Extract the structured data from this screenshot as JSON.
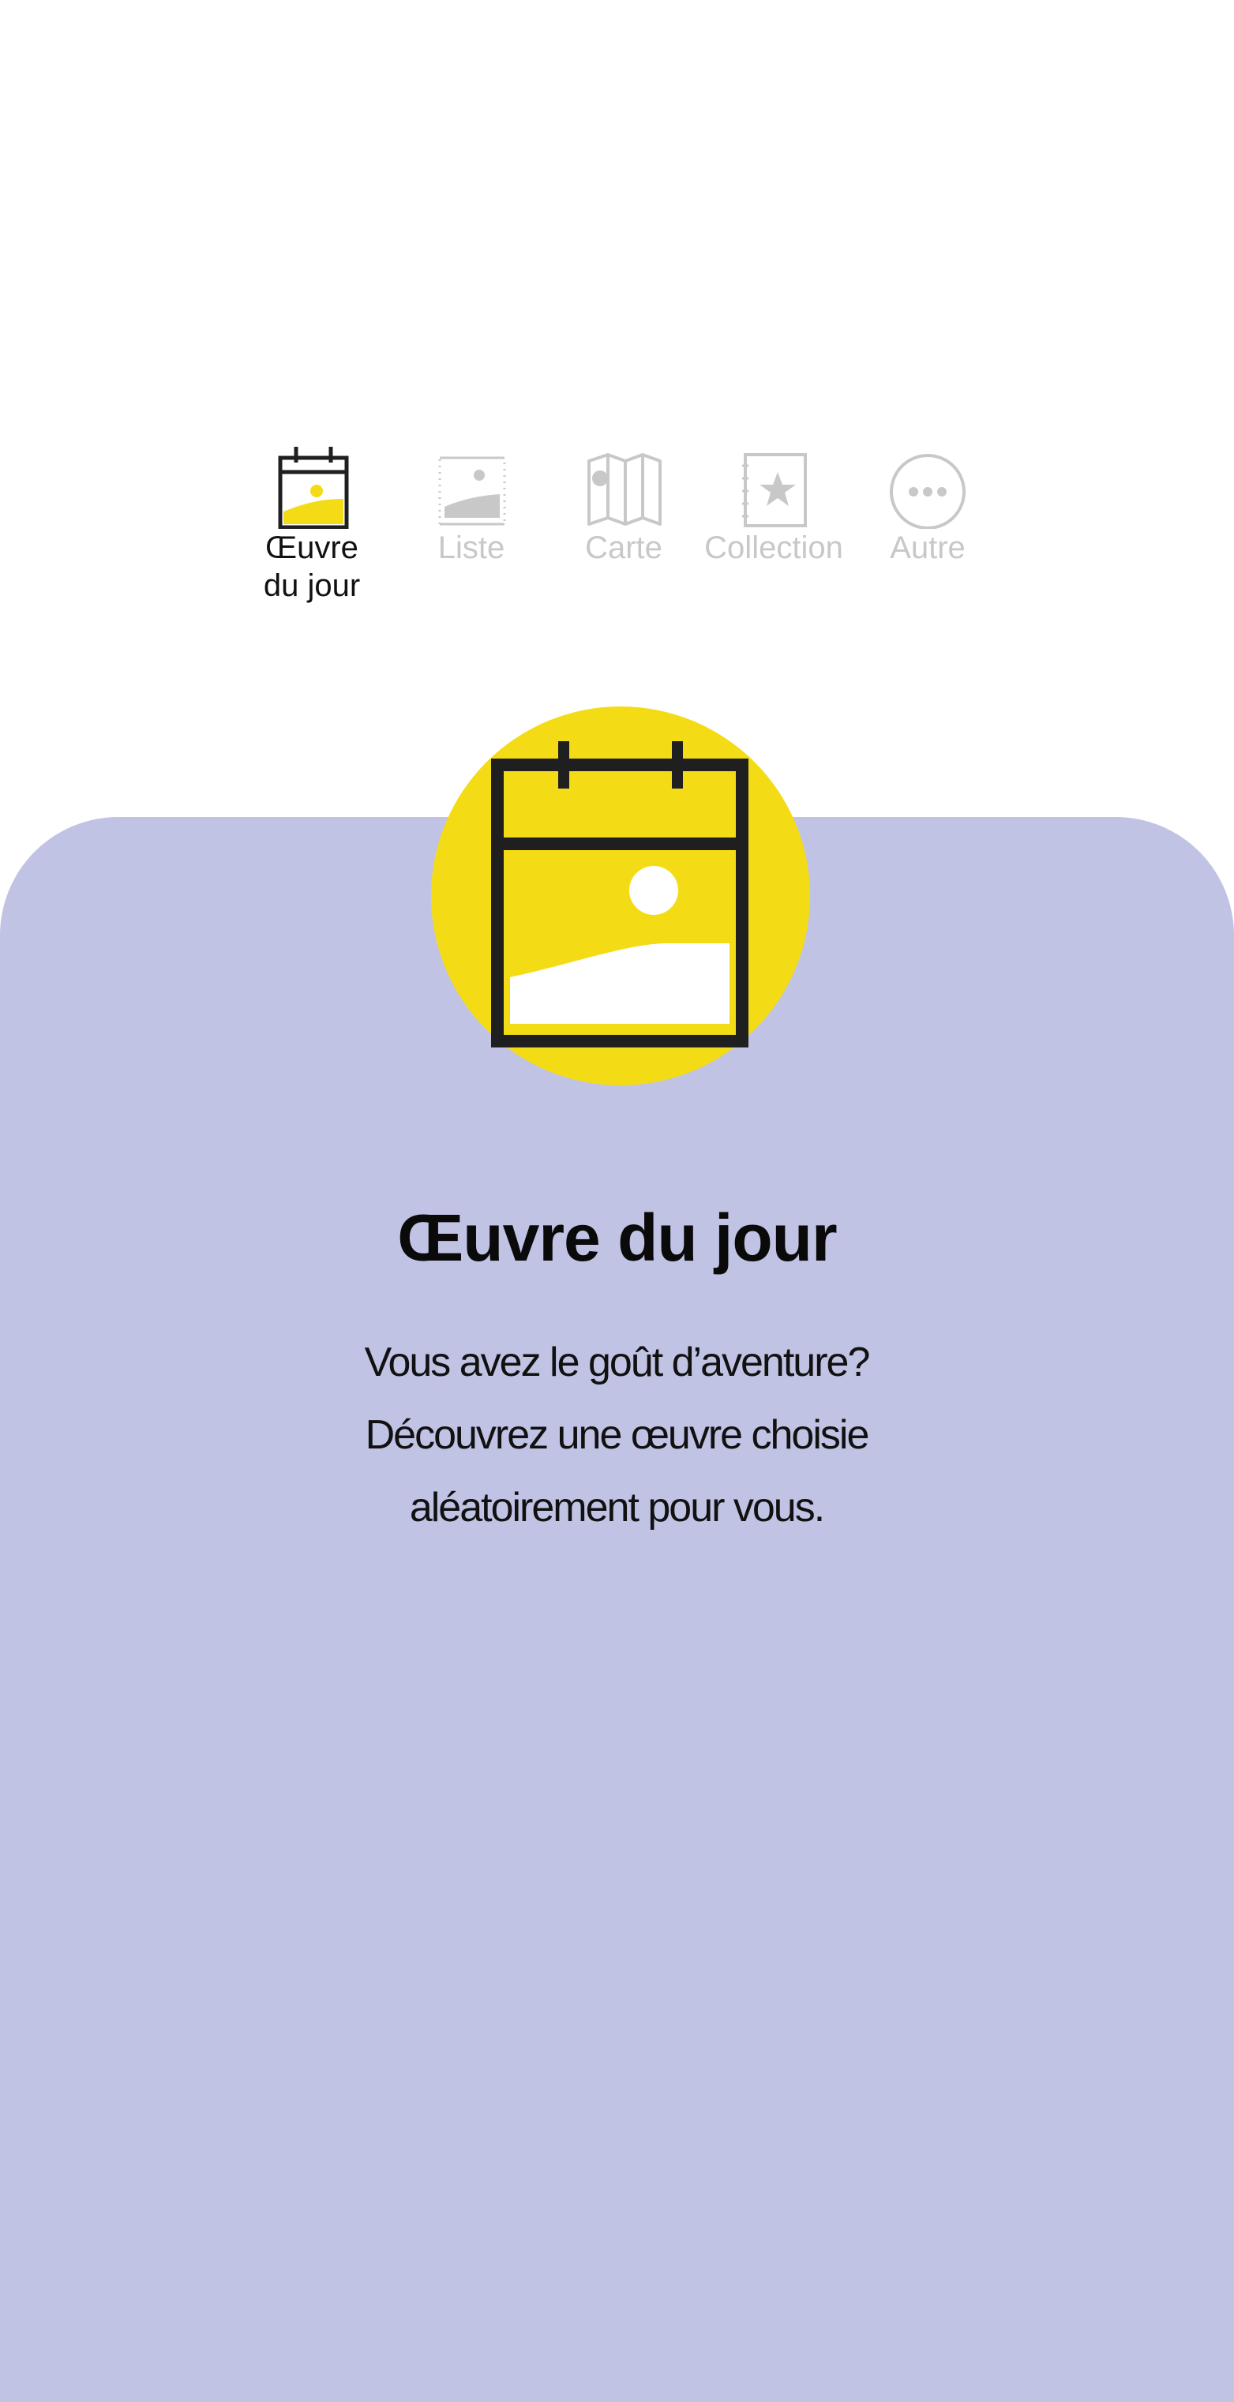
{
  "tabs": [
    {
      "label": "Œuvre\ndu jour",
      "icon": "calendar-artwork-icon",
      "active": true
    },
    {
      "label": "Liste",
      "icon": "list-artwork-icon",
      "active": false
    },
    {
      "label": "Carte",
      "icon": "folded-map-icon",
      "active": false
    },
    {
      "label": "Collection",
      "icon": "starred-notebook-icon",
      "active": false
    },
    {
      "label": "Autre",
      "icon": "more-dots-icon",
      "active": false
    }
  ],
  "hero": {
    "icon": "calendar-artwork-icon",
    "title": "Œuvre du jour",
    "description_lines": [
      "Vous avez le goût d’aventure?",
      "Découvrez une œuvre choisie",
      "aléatoirement pour vous."
    ]
  },
  "colors": {
    "accent_yellow": "#f3dc16",
    "card_background": "#c1c3e4",
    "active_text": "#111111",
    "inactive_text": "#c8c8c8",
    "icon_dark": "#1f1f1f",
    "icon_inactive": "#c8c8c8"
  }
}
